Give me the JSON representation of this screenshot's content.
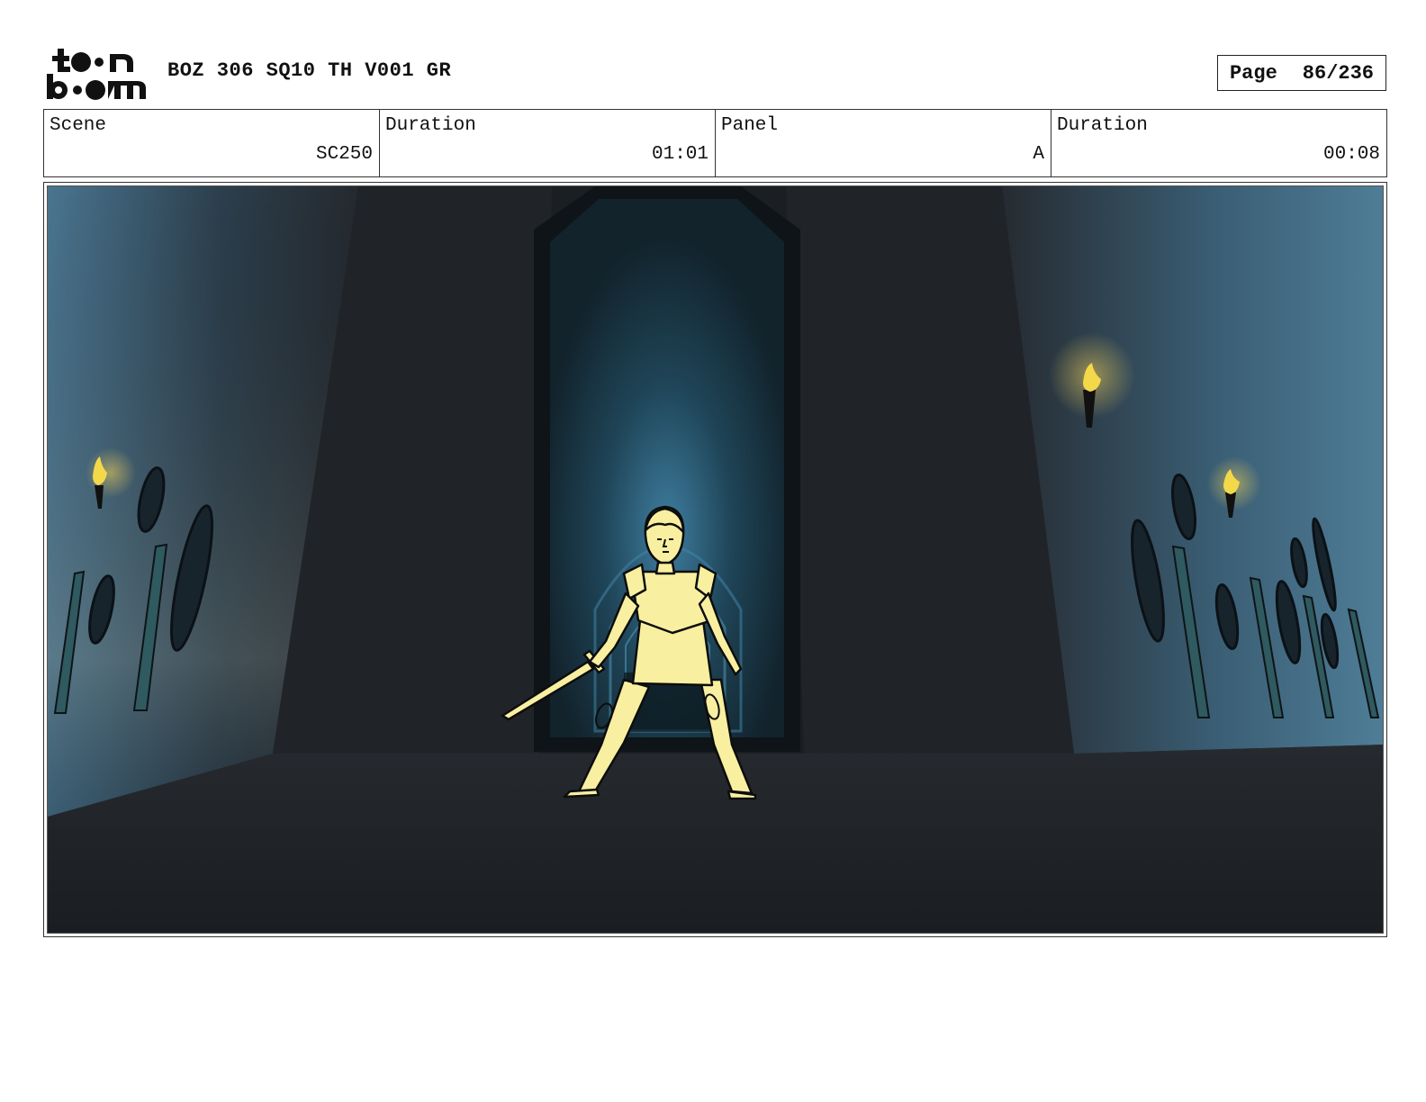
{
  "header": {
    "logo_text": "toon boom",
    "title": "BOZ 306 SQ10 TH V001 GR",
    "page_label": "Page",
    "page_number": "86/236"
  },
  "info": {
    "scene_label": "Scene",
    "scene_value": "SC250",
    "scene_duration_label": "Duration",
    "scene_duration_value": "01:01",
    "panel_label": "Panel",
    "panel_value": "A",
    "panel_duration_label": "Duration",
    "panel_duration_value": "00:08"
  },
  "panel_image": {
    "subject": "armored-figure-with-sword",
    "colors": {
      "figure_fill": "#f8f0a0",
      "wall_blue": "#3d6a86",
      "floor": "#1d2024",
      "torch_flame": "#f3d84a"
    }
  }
}
